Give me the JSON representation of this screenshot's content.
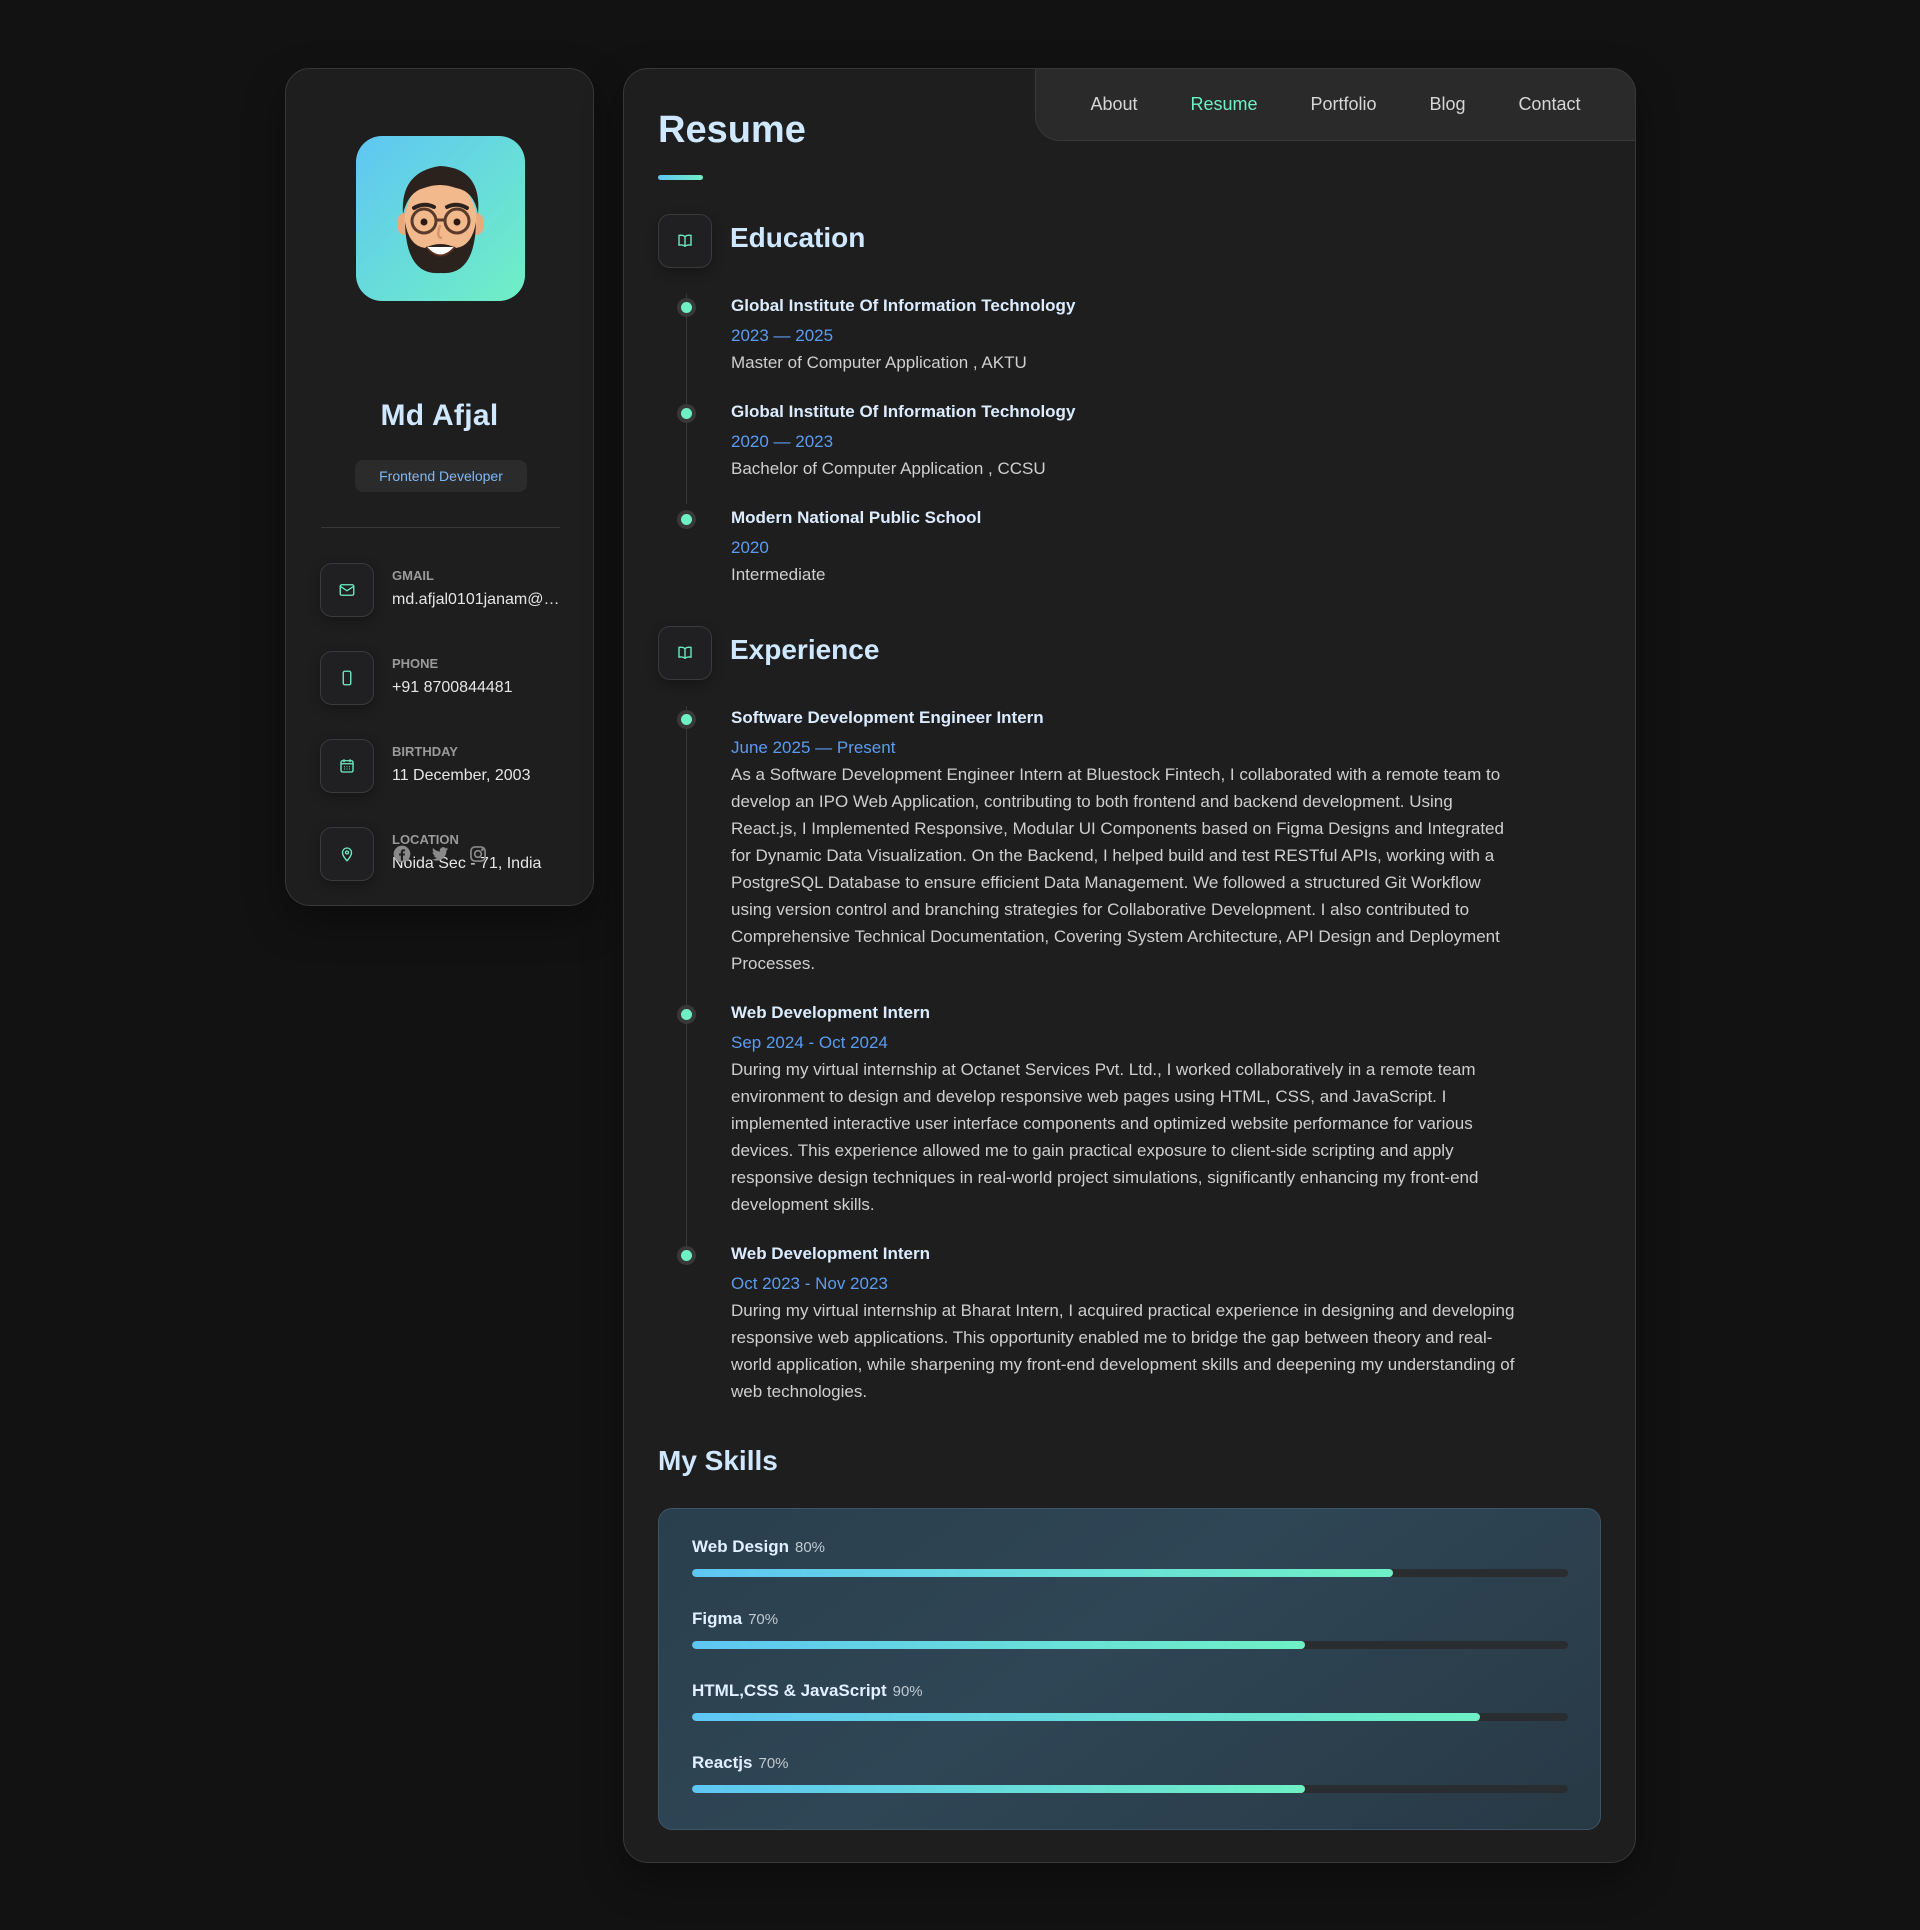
{
  "sidebar": {
    "name": "Md Afjal",
    "role": "Frontend Developer",
    "contacts": [
      {
        "label": "GMAIL",
        "value": "md.afjal0101janam@…",
        "icon": "mail-icon"
      },
      {
        "label": "PHONE",
        "value": "+91 8700844481",
        "icon": "phone-icon"
      },
      {
        "label": "BIRTHDAY",
        "value": "11 December, 2003",
        "icon": "calendar-icon"
      },
      {
        "label": "LOCATION",
        "value": "Noida Sec - 71, India",
        "icon": "location-pin-icon"
      }
    ],
    "socials": [
      "facebook-icon",
      "twitter-icon",
      "instagram-icon"
    ]
  },
  "nav": {
    "items": [
      "About",
      "Resume",
      "Portfolio",
      "Blog",
      "Contact"
    ],
    "active": "Resume"
  },
  "page": {
    "title": "Resume"
  },
  "education": {
    "title": "Education",
    "items": [
      {
        "title": "Global Institute Of Information Technology",
        "date": "2023 — 2025",
        "text": "Master of Computer Application , AKTU"
      },
      {
        "title": "Global Institute Of Information Technology",
        "date": "2020 — 2023",
        "text": "Bachelor of Computer Application , CCSU"
      },
      {
        "title": "Modern National Public School",
        "date": "2020",
        "text": "Intermediate"
      }
    ]
  },
  "experience": {
    "title": "Experience",
    "items": [
      {
        "title": "Software Development Engineer Intern",
        "date": "June 2025 — Present",
        "text": "As a Software Development Engineer Intern at Bluestock Fintech, I collaborated with a remote team to develop an IPO Web Application, contributing to both frontend and backend development. Using React.js, I Implemented Responsive, Modular UI Components based on Figma Designs and Integrated for Dynamic Data Visualization. On the Backend, I helped build and test RESTful APIs, working with a PostgreSQL Database to ensure efficient Data Management. We followed a structured Git Workflow using version control and branching strategies for Collaborative Development. I also contributed to Comprehensive Technical Documentation, Covering System Architecture, API Design and Deployment Processes."
      },
      {
        "title": "Web Development Intern",
        "date": "Sep 2024 - Oct 2024",
        "text": "During my virtual internship at Octanet Services Pvt. Ltd., I worked collaboratively in a remote team environment to design and develop responsive web pages using HTML, CSS, and JavaScript. I implemented interactive user interface components and optimized website performance for various devices. This experience allowed me to gain practical exposure to client-side scripting and apply responsive design techniques in real-world project simulations, significantly enhancing my front-end development skills."
      },
      {
        "title": "Web Development Intern",
        "date": "Oct 2023 - Nov 2023",
        "text": "During my virtual internship at Bharat Intern, I acquired practical experience in designing and developing responsive web applications. This opportunity enabled me to bridge the gap between theory and real-world application, while sharpening my front-end development skills and deepening my understanding of web technologies."
      }
    ]
  },
  "skills": {
    "title": "My Skills",
    "items": [
      {
        "name": "Web Design",
        "pct_label": "80%",
        "value": 80
      },
      {
        "name": "Figma",
        "pct_label": "70%",
        "value": 70
      },
      {
        "name": "HTML,CSS & JavaScript",
        "pct_label": "90%",
        "value": 90
      },
      {
        "name": "Reactjs",
        "pct_label": "70%",
        "value": 70
      }
    ]
  },
  "colors": {
    "accent": "#6ff0c4",
    "accent_blue": "#5fc6f3",
    "date_blue": "#5b9cf0",
    "background": "#121212",
    "panel": "#1e1e1f"
  }
}
